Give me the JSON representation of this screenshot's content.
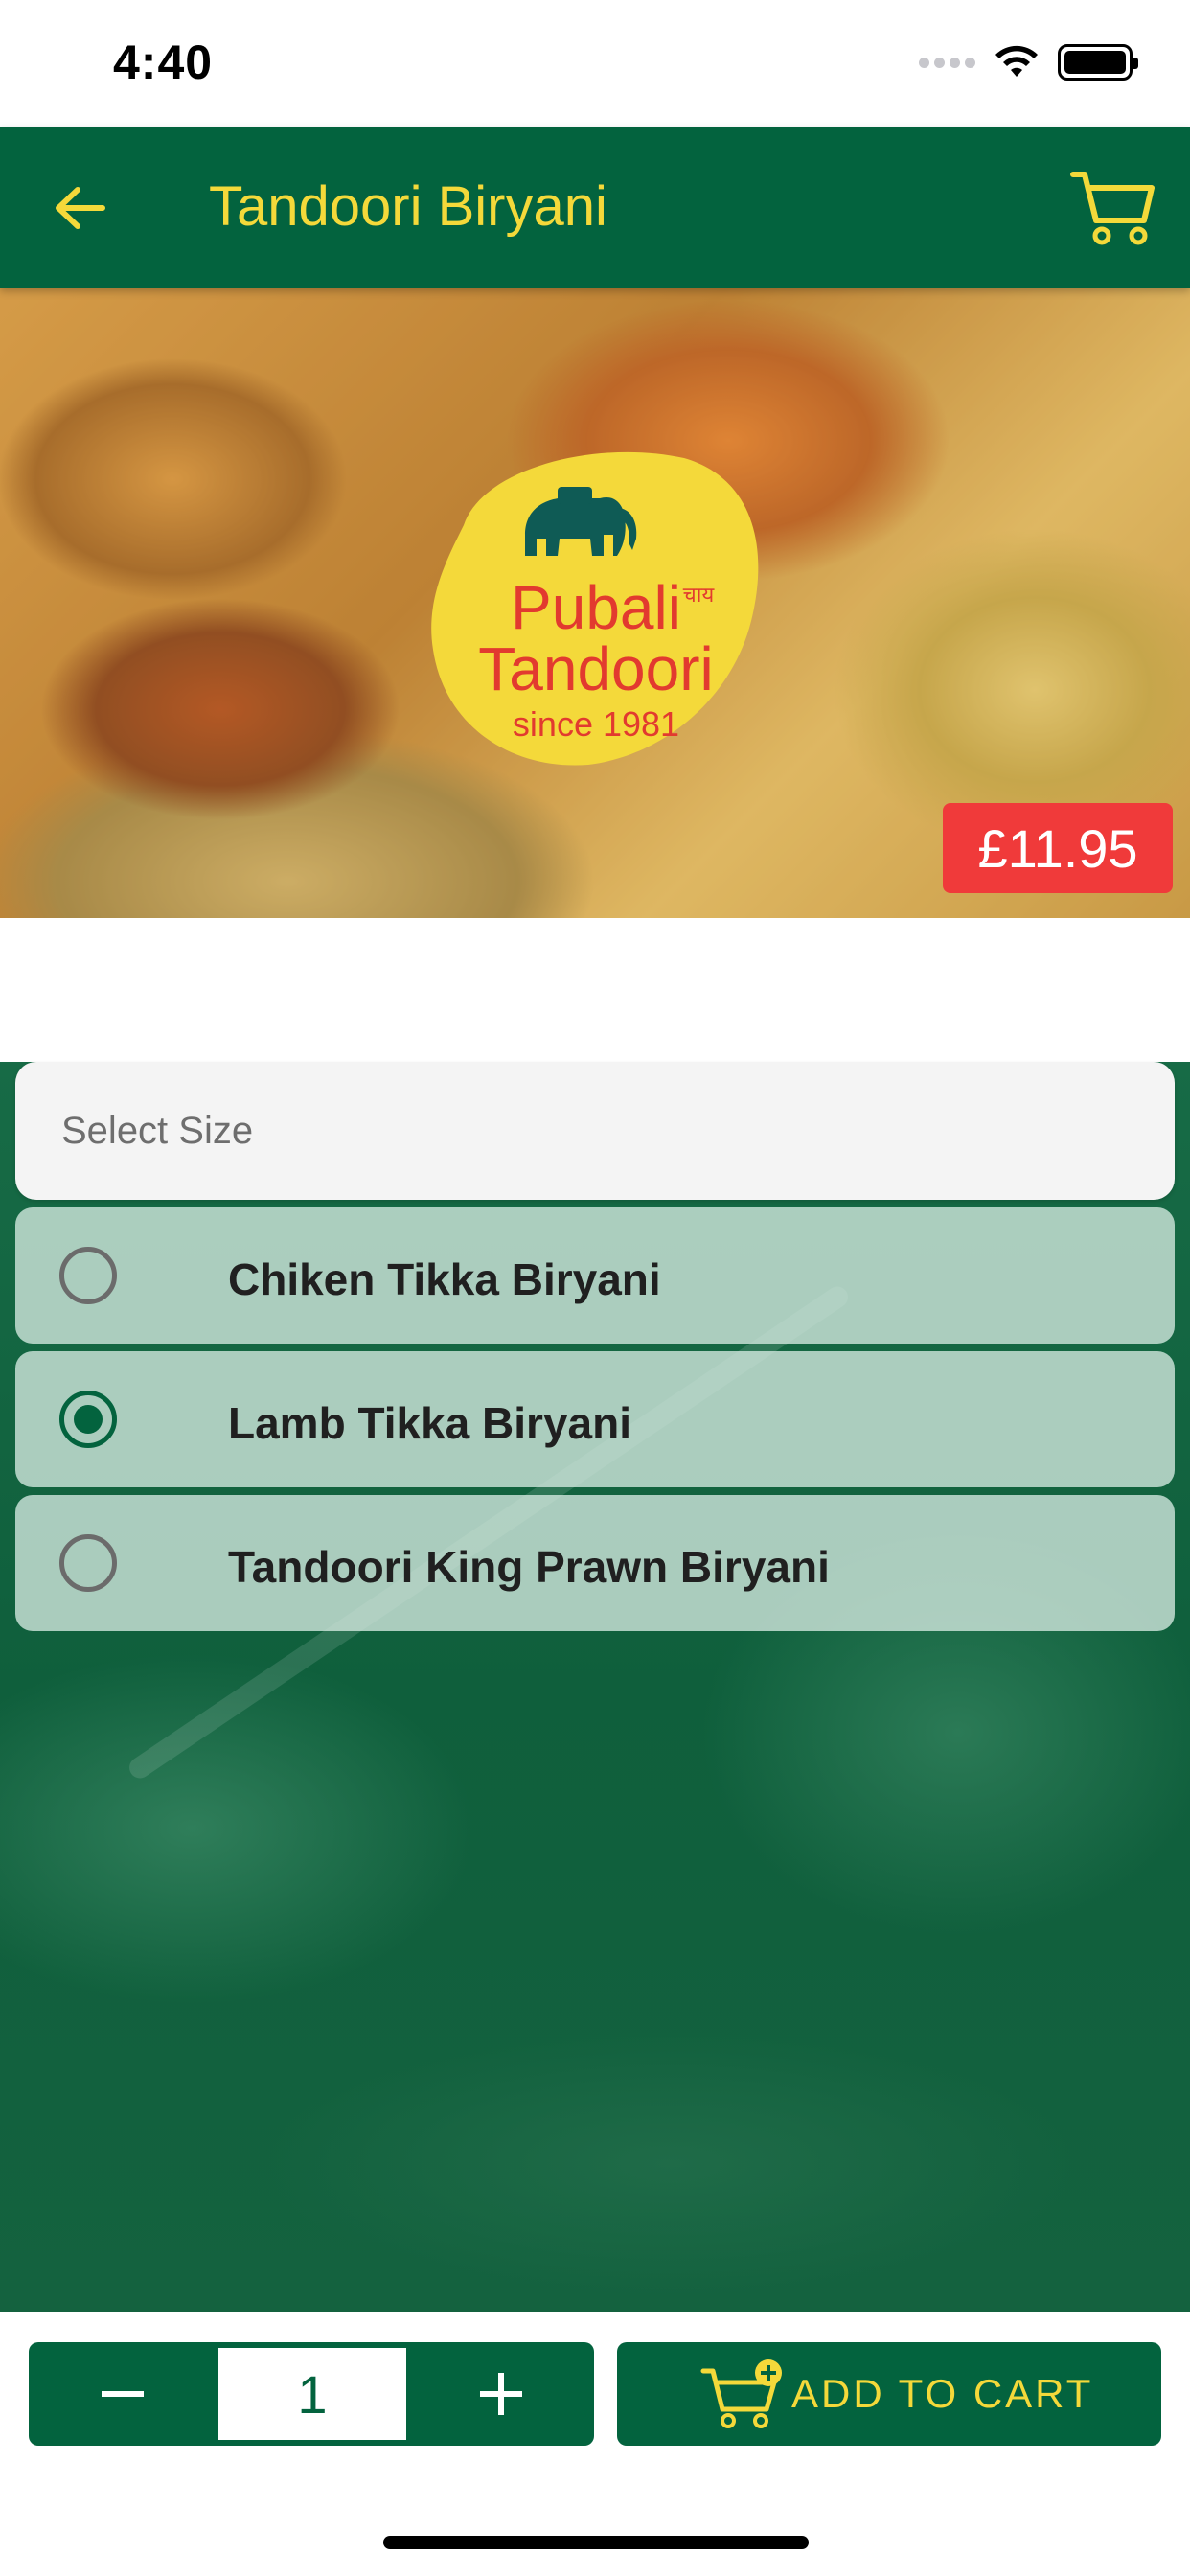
{
  "status_bar": {
    "time": "4:40"
  },
  "app_bar": {
    "title": "Tandoori Biryani",
    "back_icon": "arrow-left-icon",
    "cart_icon": "cart-icon"
  },
  "hero": {
    "logo": {
      "line1": "Pubali",
      "hindi": "चाय",
      "line2": "Tandoori",
      "tagline": "since 1981"
    },
    "price": "£11.95"
  },
  "size_selector": {
    "header": "Select Size",
    "options": [
      {
        "label": "Chiken Tikka Biryani",
        "selected": false
      },
      {
        "label": "Lamb Tikka Biryani",
        "selected": true
      },
      {
        "label": "Tandoori King Prawn Biryani",
        "selected": false
      }
    ]
  },
  "bottom_bar": {
    "quantity": "1",
    "add_to_cart_label": "ADD TO CART"
  },
  "colors": {
    "primary": "#03633e",
    "accent": "#f4d93a",
    "price": "#f03a3a"
  }
}
